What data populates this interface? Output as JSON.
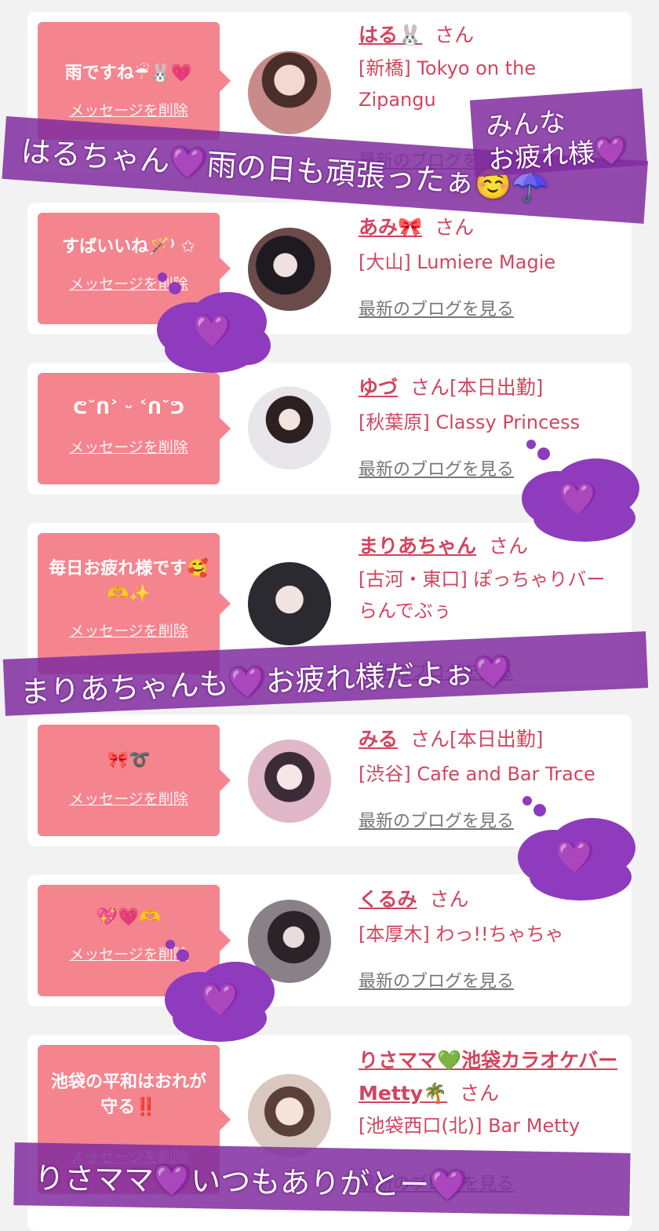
{
  "accent_color": "#f4848e",
  "link_color": "#d2455d",
  "overlay_color": "#802ca0",
  "delete_label": "メッセージを削除",
  "blog_label": "最新のブログを見る",
  "san_label": "さん",
  "cards": [
    {
      "message": "雨ですね☔🐰💗",
      "name": "はる🐰",
      "san": "さん",
      "shift": "",
      "shop": "[新橋] Tokyo on the Zipangu"
    },
    {
      "message": "すばいいね🪄⁾ ✩",
      "name": "あみ🎀",
      "san": "さん",
      "shift": "",
      "shop": "[大山] Lumiere Magie"
    },
    {
      "message": "ᕦ˘ᑎ˃ ᵕ ˂ᑎ˘ᕤ",
      "name": "ゆづ",
      "san": "さん",
      "shift": "[本日出勤]",
      "shop": "[秋葉原] Classy Princess"
    },
    {
      "message": "毎日お疲れ様です🥰🫶✨",
      "name": "まりあちゃん",
      "san": "さん",
      "shift": "",
      "shop": "[古河・東口] ぽっちゃりバー らんでぶぅ"
    },
    {
      "message": "🎀➰",
      "name": "みる",
      "san": "さん",
      "shift": "[本日出勤]",
      "shop": "[渋谷] Cafe and Bar Trace"
    },
    {
      "message": "💖💗🫶",
      "name": "くるみ",
      "san": "さん",
      "shift": "",
      "shop": "[本厚木] わっ!!ちゃちゃ"
    },
    {
      "message": "池袋の平和はおれが守る‼️",
      "name": "りさママ💚池袋カラオケバーMetty🌴",
      "san": "さん",
      "shift": "",
      "shop": "[池袋西口(北)] Bar Metty"
    }
  ],
  "overlays": {
    "banner1": "はるちゃん💜雨の日も頑張ったぁ☺️☂️",
    "banner2_line1": "みんな",
    "banner2_line2": "お疲れ様💜",
    "banner3": "まりあちゃんも💜お疲れ様だよぉ💜",
    "banner4": "りさママ💜いつもありがとー💜",
    "cloud_heart": "💜"
  }
}
